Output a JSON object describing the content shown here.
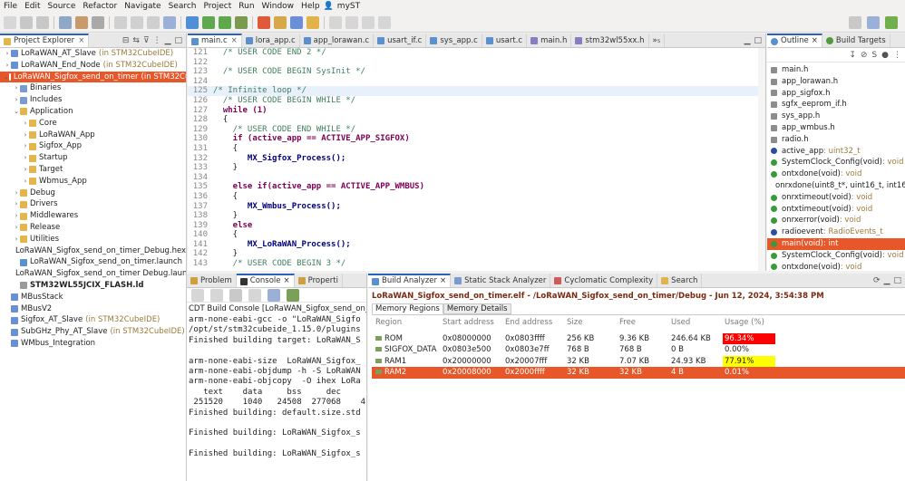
{
  "menu": [
    "File",
    "Edit",
    "Source",
    "Refactor",
    "Navigate",
    "Search",
    "Project",
    "Run",
    "Window",
    "Help",
    "myST"
  ],
  "colors": {
    "accent": "#e8572a",
    "selection_text": "#ffffff",
    "usage_rom": "#ff0000",
    "usage_ram1": "#ffff00",
    "tab_indicator": "#2962b8"
  },
  "project_explorer": {
    "tab_label": "Project Explorer",
    "tree": [
      {
        "label": "LoRaWAN_AT_Slave",
        "suffix": "(in STM32CubeIDE)",
        "depth": 0,
        "arrow": "›",
        "icon": "#6b8fd6"
      },
      {
        "label": "LoRaWAN_End_Node",
        "suffix": "(in STM32CubeIDE)",
        "depth": 0,
        "arrow": "›",
        "icon": "#6b8fd6"
      },
      {
        "label": "LoRaWAN_Sigfox_send_on_timer",
        "suffix": "(in STM32CubeIDE)",
        "depth": 0,
        "arrow": "⌄",
        "icon": "#ffffff",
        "selected": true
      },
      {
        "label": "Binaries",
        "suffix": "",
        "depth": 1,
        "arrow": "›",
        "icon": "#7a9bd0"
      },
      {
        "label": "Includes",
        "suffix": "",
        "depth": 1,
        "arrow": "›",
        "icon": "#7a9bd0"
      },
      {
        "label": "Application",
        "suffix": "",
        "depth": 1,
        "arrow": "⌄",
        "icon": "#e3b54d"
      },
      {
        "label": "Core",
        "suffix": "",
        "depth": 2,
        "arrow": "›",
        "icon": "#e3b54d"
      },
      {
        "label": "LoRaWAN_App",
        "suffix": "",
        "depth": 2,
        "arrow": "›",
        "icon": "#e3b54d"
      },
      {
        "label": "Sigfox_App",
        "suffix": "",
        "depth": 2,
        "arrow": "›",
        "icon": "#e3b54d"
      },
      {
        "label": "Startup",
        "suffix": "",
        "depth": 2,
        "arrow": "›",
        "icon": "#e3b54d"
      },
      {
        "label": "Target",
        "suffix": "",
        "depth": 2,
        "arrow": "›",
        "icon": "#e3b54d"
      },
      {
        "label": "Wbmus_App",
        "suffix": "",
        "depth": 2,
        "arrow": "›",
        "icon": "#e3b54d"
      },
      {
        "label": "Debug",
        "suffix": "",
        "depth": 1,
        "arrow": "›",
        "icon": "#e3b54d"
      },
      {
        "label": "Drivers",
        "suffix": "",
        "depth": 1,
        "arrow": "›",
        "icon": "#e3b54d"
      },
      {
        "label": "Middlewares",
        "suffix": "",
        "depth": 1,
        "arrow": "›",
        "icon": "#e3b54d"
      },
      {
        "label": "Release",
        "suffix": "",
        "depth": 1,
        "arrow": "›",
        "icon": "#e3b54d"
      },
      {
        "label": "Utilities",
        "suffix": "",
        "depth": 1,
        "arrow": "›",
        "icon": "#e3b54d"
      },
      {
        "label": "LoRaWAN_Sigfox_send_on_timer_Debug.hex",
        "suffix": "",
        "depth": 1,
        "arrow": "",
        "icon": "#9a9a9a"
      },
      {
        "label": "LoRaWAN_Sigfox_send_on_timer.launch",
        "suffix": "",
        "depth": 1,
        "arrow": "",
        "icon": "#5a8fd0"
      },
      {
        "label": "LoRaWAN_Sigfox_send_on_timer Debug.launch",
        "suffix": "",
        "depth": 1,
        "arrow": "",
        "icon": "#5a8fd0"
      },
      {
        "label": "STM32WL55JCIX_FLASH.ld",
        "suffix": "",
        "depth": 1,
        "arrow": "",
        "icon": "#9a9a9a",
        "bold": true
      },
      {
        "label": "MBusStack",
        "suffix": "",
        "depth": 0,
        "arrow": "",
        "icon": "#6b8fd6"
      },
      {
        "label": "MBusV2",
        "suffix": "",
        "depth": 0,
        "arrow": "",
        "icon": "#6b8fd6"
      },
      {
        "label": "Sigfox_AT_Slave",
        "suffix": "(in STM32CubeIDE)",
        "depth": 0,
        "arrow": "",
        "icon": "#6b8fd6"
      },
      {
        "label": "SubGHz_Phy_AT_Slave",
        "suffix": "(in STM32CubeIDE)",
        "depth": 0,
        "arrow": "",
        "icon": "#6b8fd6"
      },
      {
        "label": "WMbus_Integration",
        "suffix": "",
        "depth": 0,
        "arrow": "",
        "icon": "#6b8fd6"
      }
    ]
  },
  "editor": {
    "tabs": [
      {
        "label": "main.c",
        "active": true
      },
      {
        "label": "lora_app.c"
      },
      {
        "label": "app_lorawan.c"
      },
      {
        "label": "usart_if.c"
      },
      {
        "label": "sys_app.c"
      },
      {
        "label": "usart.c"
      },
      {
        "label": "main.h"
      },
      {
        "label": "stm32wl55xx.h"
      },
      {
        "label": "»₅"
      }
    ],
    "lines": [
      {
        "n": "121",
        "t": "  /* USER CODE END 2 */",
        "c": "cmt"
      },
      {
        "n": "122",
        "t": "",
        "c": ""
      },
      {
        "n": "123",
        "t": "  /* USER CODE BEGIN SysInit */",
        "c": "cmt"
      },
      {
        "n": "124",
        "t": "",
        "c": ""
      },
      {
        "n": "125",
        "t": "/* Infinite loop */",
        "c": "cmt",
        "hl": true
      },
      {
        "n": "126",
        "t": "  /* USER CODE BEGIN WHILE */",
        "c": "cmt"
      },
      {
        "n": "127",
        "t": "  while (1)",
        "c": "kw"
      },
      {
        "n": "128",
        "t": "  {",
        "c": ""
      },
      {
        "n": "129",
        "t": "    /* USER CODE END WHILE */",
        "c": "cmt"
      },
      {
        "n": "130",
        "t": "    if (active_app == ACTIVE_APP_SIGFOX)",
        "c": "kw"
      },
      {
        "n": "131",
        "t": "    {",
        "c": ""
      },
      {
        "n": "132",
        "t": "       MX_Sigfox_Process();",
        "c": "fn"
      },
      {
        "n": "133",
        "t": "    }",
        "c": ""
      },
      {
        "n": "134",
        "t": "",
        "c": ""
      },
      {
        "n": "135",
        "t": "    else if(active_app == ACTIVE_APP_WMBUS)",
        "c": "kw"
      },
      {
        "n": "136",
        "t": "    {",
        "c": ""
      },
      {
        "n": "137",
        "t": "       MX_Wmbus_Process();",
        "c": "fn"
      },
      {
        "n": "138",
        "t": "    }",
        "c": ""
      },
      {
        "n": "139",
        "t": "    else",
        "c": "kw"
      },
      {
        "n": "140",
        "t": "    {",
        "c": ""
      },
      {
        "n": "141",
        "t": "       MX_LoRaWAN_Process();",
        "c": "fn"
      },
      {
        "n": "142",
        "t": "    }",
        "c": ""
      },
      {
        "n": "143",
        "t": "    /* USER CODE BEGIN 3 */",
        "c": "cmt"
      }
    ]
  },
  "outline": {
    "tabs": [
      "Outline",
      "Build Targets"
    ],
    "items": [
      {
        "label": "main.h",
        "type": "",
        "dot": "#8c8c8c"
      },
      {
        "label": "app_lorawan.h",
        "type": "",
        "dot": "#8c8c8c"
      },
      {
        "label": "app_sigfox.h",
        "type": "",
        "dot": "#8c8c8c"
      },
      {
        "label": "sgfx_eeprom_if.h",
        "type": "",
        "dot": "#8c8c8c"
      },
      {
        "label": "sys_app.h",
        "type": "",
        "dot": "#8c8c8c"
      },
      {
        "label": "app_wmbus.h",
        "type": "",
        "dot": "#8c8c8c"
      },
      {
        "label": "radio.h",
        "type": "",
        "dot": "#8c8c8c"
      },
      {
        "label": "active_app",
        "type": " : uint32_t",
        "dot": "#2b4fa0"
      },
      {
        "label": "SystemClock_Config(void)",
        "type": " : void",
        "dot": "#3a9a3a"
      },
      {
        "label": "ontxdone(void)",
        "type": " : void",
        "dot": "#3a9a3a"
      },
      {
        "label": "onrxdone(uint8_t*, uint16_t, int16_t",
        "type": "",
        "dot": "#3a9a3a"
      },
      {
        "label": "onrxtimeout(void)",
        "type": " : void",
        "dot": "#3a9a3a"
      },
      {
        "label": "ontxtimeout(void)",
        "type": " : void",
        "dot": "#3a9a3a"
      },
      {
        "label": "onrxerror(void)",
        "type": " : void",
        "dot": "#3a9a3a"
      },
      {
        "label": "radioevent",
        "type": " : RadioEvents_t",
        "dot": "#2b4fa0"
      },
      {
        "label": "main(void)",
        "type": " : int",
        "dot": "#3a9a3a",
        "selected": true
      },
      {
        "label": "SystemClock_Config(void)",
        "type": " : void",
        "dot": "#3a9a3a"
      },
      {
        "label": "ontxdone(void)",
        "type": " : void",
        "dot": "#3a9a3a"
      }
    ]
  },
  "console": {
    "tabs": [
      "Problem",
      "Console",
      "Properti"
    ],
    "title": "CDT Build Console [LoRaWAN_Sigfox_send_on_timer]",
    "lines": [
      "arm-none-eabi-gcc -o \"LoRaWAN_Sigfo",
      "/opt/st/stm32cubeide_1.15.0/plugins",
      "Finished building target: LoRaWAN_S",
      "",
      "arm-none-eabi-size  LoRaWAN_Sigfox_",
      "arm-none-eabi-objdump -h -S LoRaWAN",
      "arm-none-eabi-objcopy  -O ihex LoRa",
      "   text    data     bss     dec    ",
      " 251520    1040   24508  277068    4",
      "Finished building: default.size.std",
      "",
      "Finished building: LoRaWAN_Sigfox_s",
      "",
      "Finished building: LoRaWAN_Sigfox_s",
      "",
      "",
      "",
      "15:54:39 Build Finished. 0 errors, "
    ]
  },
  "build_analyzer": {
    "tabs": [
      "Build Analyzer",
      "Static Stack Analyzer",
      "Cyclomatic Complexity",
      "Search"
    ],
    "header": "LoRaWAN_Sigfox_send_on_timer.elf - /LoRaWAN_Sigfox_send_on_timer/Debug - Jun 12, 2024, 3:54:38 PM",
    "subtabs": [
      "Memory Regions",
      "Memory Details"
    ],
    "columns": [
      "Region",
      "Start address",
      "End address",
      "Size",
      "Free",
      "Used",
      "Usage (%)"
    ],
    "rows": [
      {
        "region": "ROM",
        "start": "0x08000000",
        "end": "0x0803ffff",
        "size": "256 KB",
        "free": "9.36 KB",
        "used": "246.64 KB",
        "usage": "96.34%",
        "usage_pct": 96.34,
        "usage_color": "#ff0000"
      },
      {
        "region": "SIGFOX_DATA",
        "start": "0x0803e500",
        "end": "0x0803e7ff",
        "size": "768 B",
        "free": "768 B",
        "used": "0 B",
        "usage": "0.00%",
        "usage_pct": 0,
        "usage_color": ""
      },
      {
        "region": "RAM1",
        "start": "0x20000000",
        "end": "0x20007fff",
        "size": "32 KB",
        "free": "7.07 KB",
        "used": "24.93 KB",
        "usage": "77.91%",
        "usage_pct": 77.91,
        "usage_color": "#ffff00"
      },
      {
        "region": "RAM2",
        "start": "0x20008000",
        "end": "0x2000ffff",
        "size": "32 KB",
        "free": "32 KB",
        "used": "4 B",
        "usage": "0.01%",
        "usage_pct": 0.01,
        "usage_color": "",
        "selected": true
      }
    ]
  }
}
